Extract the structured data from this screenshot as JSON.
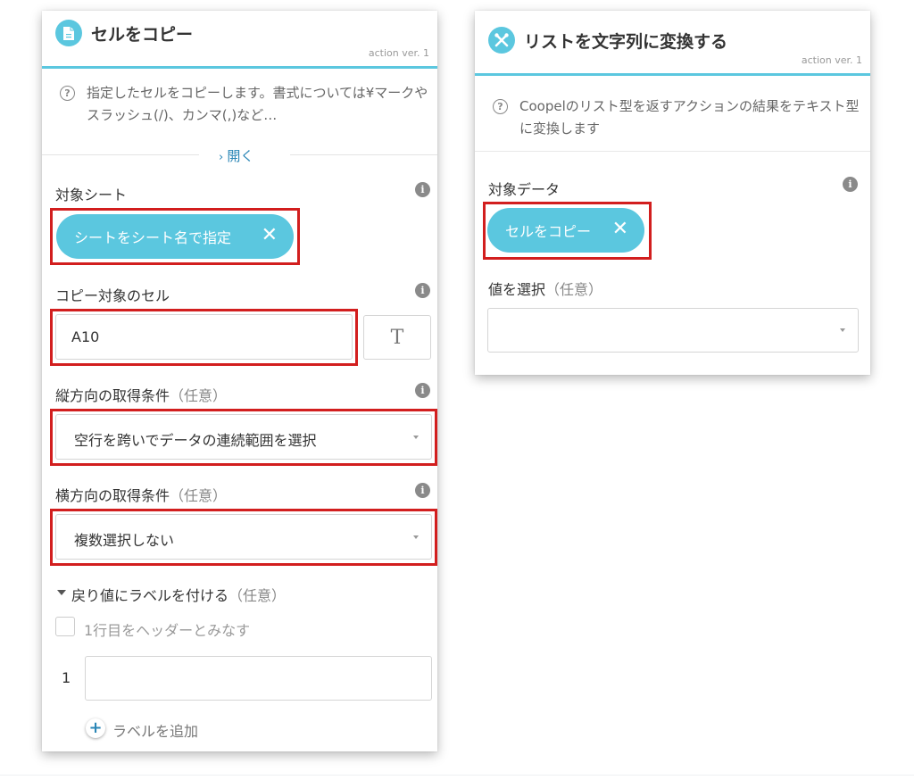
{
  "panel_copy": {
    "title": "セルをコピー",
    "version": "action ver. 1",
    "header_icon": "document-icon",
    "description": "指定したセルをコピーします。書式については¥マークやスラッシュ(/)、カンマ(,)など…",
    "open_label": "開く",
    "target_sheet": {
      "label": "対象シート",
      "pill_label": "シートをシート名で指定"
    },
    "copy_cell": {
      "label": "コピー対象のセル",
      "value": "A10",
      "text_mode_glyph": "T"
    },
    "vertical_condition": {
      "label": "縦方向の取得条件",
      "optional": "（任意）",
      "selected": "空行を跨いでデータの連続範囲を選択"
    },
    "horizontal_condition": {
      "label": "横方向の取得条件",
      "optional": "（任意）",
      "selected": "複数選択しない"
    },
    "return_label": {
      "label": "戻り値にラベルを付ける",
      "optional": "（任意）",
      "first_row_header": "1行目をヘッダーとみなす",
      "row_number": "1",
      "row_value": "",
      "add_label": "ラベルを追加"
    }
  },
  "panel_list": {
    "title": "リストを文字列に変換する",
    "version": "action ver. 1",
    "header_icon": "tools-icon",
    "description": "Coopelのリスト型を返すアクションの結果をテキスト型に変換します",
    "target_data": {
      "label": "対象データ",
      "pill_label": "セルをコピー"
    },
    "value_select": {
      "label": "値を選択",
      "optional": "（任意）",
      "selected": ""
    }
  },
  "colors": {
    "accent": "#5bc7df",
    "highlight_red": "#d21e1e",
    "link_blue": "#2a86b6"
  }
}
